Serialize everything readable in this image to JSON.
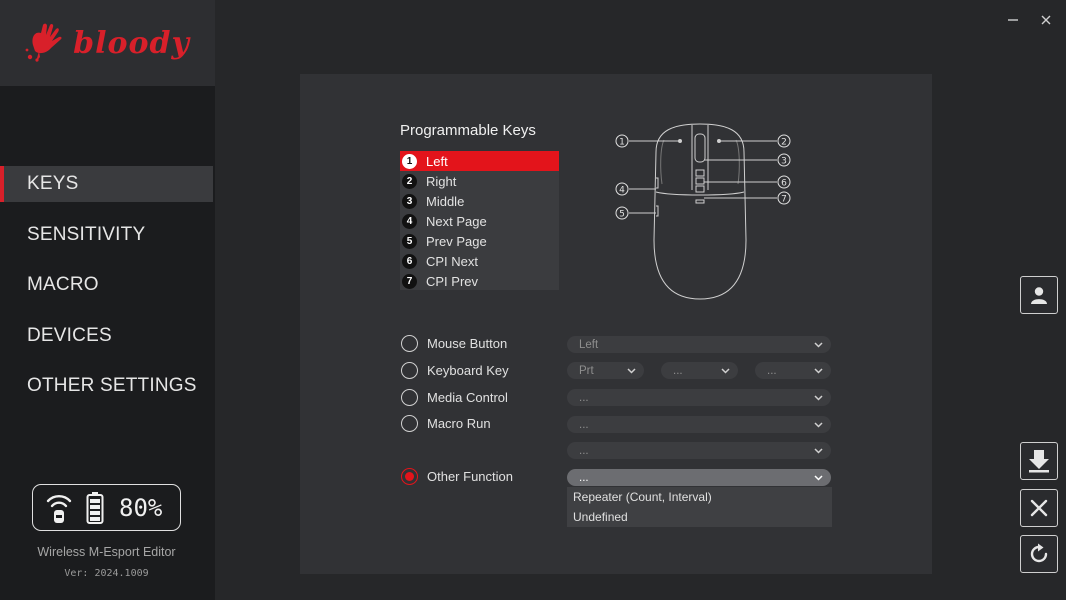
{
  "brand": {
    "logo_text": "bloody",
    "accent_color": "#d8202a"
  },
  "window": {
    "minimize_label": "—",
    "close_label": "✕"
  },
  "nav": {
    "items": [
      {
        "label": "KEYS",
        "active": true
      },
      {
        "label": "SENSITIVITY"
      },
      {
        "label": "MACRO"
      },
      {
        "label": "DEVICES"
      },
      {
        "label": "OTHER SETTINGS"
      }
    ]
  },
  "status": {
    "battery_percent": "80%",
    "battery_level": 0.8,
    "connection": "wireless"
  },
  "footer": {
    "app_name": "Wireless M-Esport Editor",
    "version": "Ver: 2024.1009"
  },
  "programmable_keys": {
    "title": "Programmable Keys",
    "items": [
      {
        "num": "1",
        "label": "Left",
        "active": true
      },
      {
        "num": "2",
        "label": "Right"
      },
      {
        "num": "3",
        "label": "Middle"
      },
      {
        "num": "4",
        "label": "Next Page"
      },
      {
        "num": "5",
        "label": "Prev Page"
      },
      {
        "num": "6",
        "label": "CPI Next"
      },
      {
        "num": "7",
        "label": "CPI Prev"
      }
    ]
  },
  "diagram": {
    "callouts": [
      "1",
      "2",
      "3",
      "4",
      "5",
      "6",
      "7"
    ]
  },
  "options": {
    "mouse_button": {
      "label": "Mouse Button",
      "value": "Left"
    },
    "keyboard_key": {
      "label": "Keyboard Key",
      "value1": "Prt",
      "value2": "...",
      "value3": "..."
    },
    "media_control": {
      "label": "Media Control",
      "value": "..."
    },
    "macro_run": {
      "label": "Macro Run",
      "value": "...",
      "value2": "..."
    },
    "other_function": {
      "label": "Other Function",
      "value": "...",
      "selected": true
    },
    "other_function_menu": [
      "Repeater (Count, Interval)",
      "Undefined"
    ]
  },
  "side_buttons": [
    "user-icon",
    "download-icon",
    "close-icon",
    "refresh-icon"
  ]
}
